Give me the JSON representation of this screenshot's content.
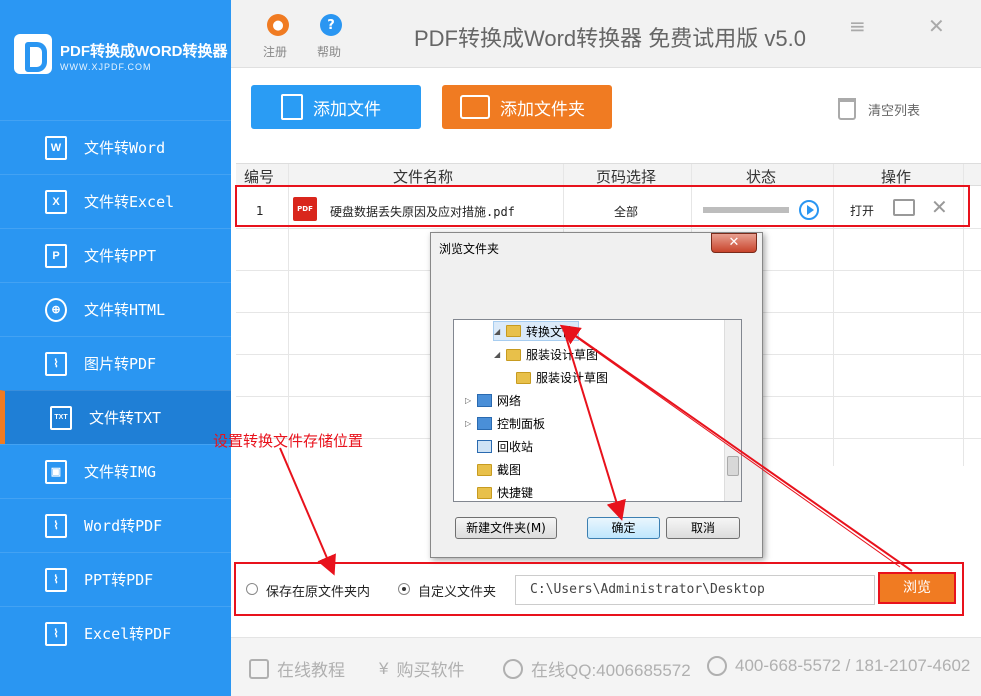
{
  "sidebar": {
    "logo_title": "PDF转换成WORD转换器",
    "logo_sub": "WWW.XJPDF.COM",
    "items": [
      {
        "label": "文件转Word",
        "icon": "word-file-icon",
        "glyph": "W"
      },
      {
        "label": "文件转Excel",
        "icon": "excel-file-icon",
        "glyph": "X"
      },
      {
        "label": "文件转PPT",
        "icon": "ppt-file-icon",
        "glyph": "P"
      },
      {
        "label": "文件转HTML",
        "icon": "globe-icon",
        "glyph": "⊕"
      },
      {
        "label": "图片转PDF",
        "icon": "pdf-file-icon",
        "glyph": "⌇"
      },
      {
        "label": "文件转TXT",
        "icon": "txt-file-icon",
        "glyph": "TXT"
      },
      {
        "label": "文件转IMG",
        "icon": "image-icon",
        "glyph": "▣"
      },
      {
        "label": "Word转PDF",
        "icon": "pdf-file-icon",
        "glyph": "⌇"
      },
      {
        "label": "PPT转PDF",
        "icon": "pdf-file-icon",
        "glyph": "⌇"
      },
      {
        "label": "Excel转PDF",
        "icon": "pdf-file-icon",
        "glyph": "⌇"
      }
    ],
    "active_index": 5
  },
  "topbar": {
    "register_label": "注册",
    "help_label": "帮助",
    "title": "PDF转换成Word转换器 免费试用版 v5.0",
    "minimize_glyph": "≡",
    "close_glyph": "✕"
  },
  "toolbar": {
    "add_file": "添加文件",
    "add_folder": "添加文件夹",
    "clear_list": "清空列表"
  },
  "table": {
    "headers": [
      "编号",
      "文件名称",
      "页码选择",
      "状态",
      "操作"
    ],
    "rows": [
      {
        "index": "1",
        "file_icon_text": "PDF",
        "filename": "硬盘数据丢失原因及应对措施.pdf",
        "pages": "全部",
        "progress": 0,
        "action_open": "打开"
      }
    ]
  },
  "annotation": {
    "text": "设置转换文件存储位置"
  },
  "dialog": {
    "title": "浏览文件夹",
    "close_glyph": "✕",
    "tree": [
      {
        "label": "转换文件",
        "selected": true,
        "expander": "◢"
      },
      {
        "label": "服装设计草图",
        "expander": "◢"
      },
      {
        "label": "服装设计草图",
        "expander": ""
      },
      {
        "label": "网络",
        "expander": "▷"
      },
      {
        "label": "控制面板",
        "expander": "▷"
      },
      {
        "label": "回收站",
        "expander": ""
      },
      {
        "label": "截图",
        "expander": ""
      },
      {
        "label": "快捷键",
        "expander": ""
      }
    ],
    "new_folder": "新建文件夹(M)",
    "ok": "确定",
    "cancel": "取消"
  },
  "save": {
    "option_original": "保存在原文件夹内",
    "option_custom": "自定义文件夹",
    "selected": "custom",
    "path": "C:\\Users\\Administrator\\Desktop",
    "browse": "浏览"
  },
  "footer": {
    "tutorial": "在线教程",
    "buy": "购买软件",
    "qq": "在线QQ:4006685572",
    "phone": "400-668-5572 / 181-2107-4602"
  },
  "colors": {
    "sidebar_blue": "#2a96f2",
    "orange": "#f07b22",
    "annotation_red": "#e8121c"
  }
}
